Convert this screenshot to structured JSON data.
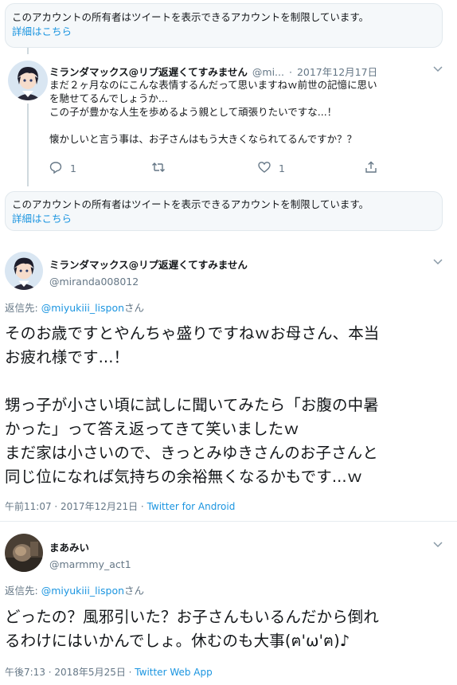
{
  "notice": {
    "text": "このアカウントの所有者はツイートを表示できるアカウントを制限しています。",
    "link": "詳細はこちら"
  },
  "tweet1": {
    "display_name": "ミランダマックス@リプ返遅くてすみません",
    "handle": "@mi...",
    "sep": "·",
    "date": "2017年12月17日",
    "lines": [
      "まだ２ヶ月なのにこんな表情するんだって思いますねｗ前世の記憶に思い",
      "を馳せてるんでしょうか...",
      "この子が豊かな人生を歩めるよう親として頑張りたいですな...！",
      "",
      "懐かしいと言う事は、お子さんはもう大きくなられてるんですか？？"
    ],
    "reply_count": "1",
    "like_count": "1"
  },
  "tweet2": {
    "display_name": "ミランダマックス@リプ返遅くてすみません",
    "handle": "@miranda008012",
    "reply_prefix": "返信先: ",
    "reply_mention": "@miyukiii_lispon",
    "reply_suffix": "さん",
    "lines": [
      "そのお歳ですとやんちゃ盛りですねｗお母さん、本当",
      "お疲れ様です...！",
      "",
      "甥っ子が小さい頃に試しに聞いてみたら「お腹の中暑",
      "かった」って答え返ってきて笑いましたｗ",
      "まだ家は小さいので、きっとみゆきさんのお子さんと",
      "同じ位になれば気持ちの余裕無くなるかもです...ｗ"
    ],
    "time": "午前11:07 · 2017年12月21日 · ",
    "source": "Twitter for Android"
  },
  "tweet3": {
    "display_name": "まあみい",
    "handle": "@marmmy_act1",
    "reply_prefix": "返信先: ",
    "reply_mention": "@miyukiii_lispon",
    "reply_suffix": "さん",
    "lines": [
      "どったの？風邪引いた？お子さんもいるんだから倒れ",
      "るわけにはいかんでしょ。休むのも大事(ฅ'ω'ฅ)♪"
    ],
    "time": "午後7:13 · 2018年5月25日 · ",
    "source": "Twitter Web App"
  },
  "icons": [
    "chevron-down-icon",
    "reply-icon",
    "retweet-icon",
    "like-icon",
    "share-icon"
  ],
  "colors": {
    "link": "#1b95e0",
    "muted": "#657786",
    "notice_bg": "#f5f8fa"
  }
}
